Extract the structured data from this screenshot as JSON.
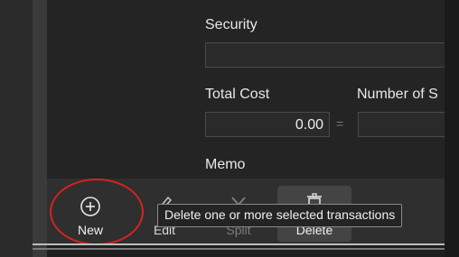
{
  "form": {
    "security_label": "Security",
    "total_cost_label": "Total Cost",
    "total_cost_value": "0.00",
    "equals_sign": "=",
    "number_of_shares_label": "Number of S",
    "memo_label": "Memo"
  },
  "toolbar": {
    "new_label": "New",
    "edit_label": "Edit",
    "split_label": "Split",
    "delete_label": "Delete"
  },
  "tooltip": {
    "text": "Delete one or more selected transactions"
  },
  "colors": {
    "annotation": "#d8231f",
    "background": "#1e1e1e"
  }
}
